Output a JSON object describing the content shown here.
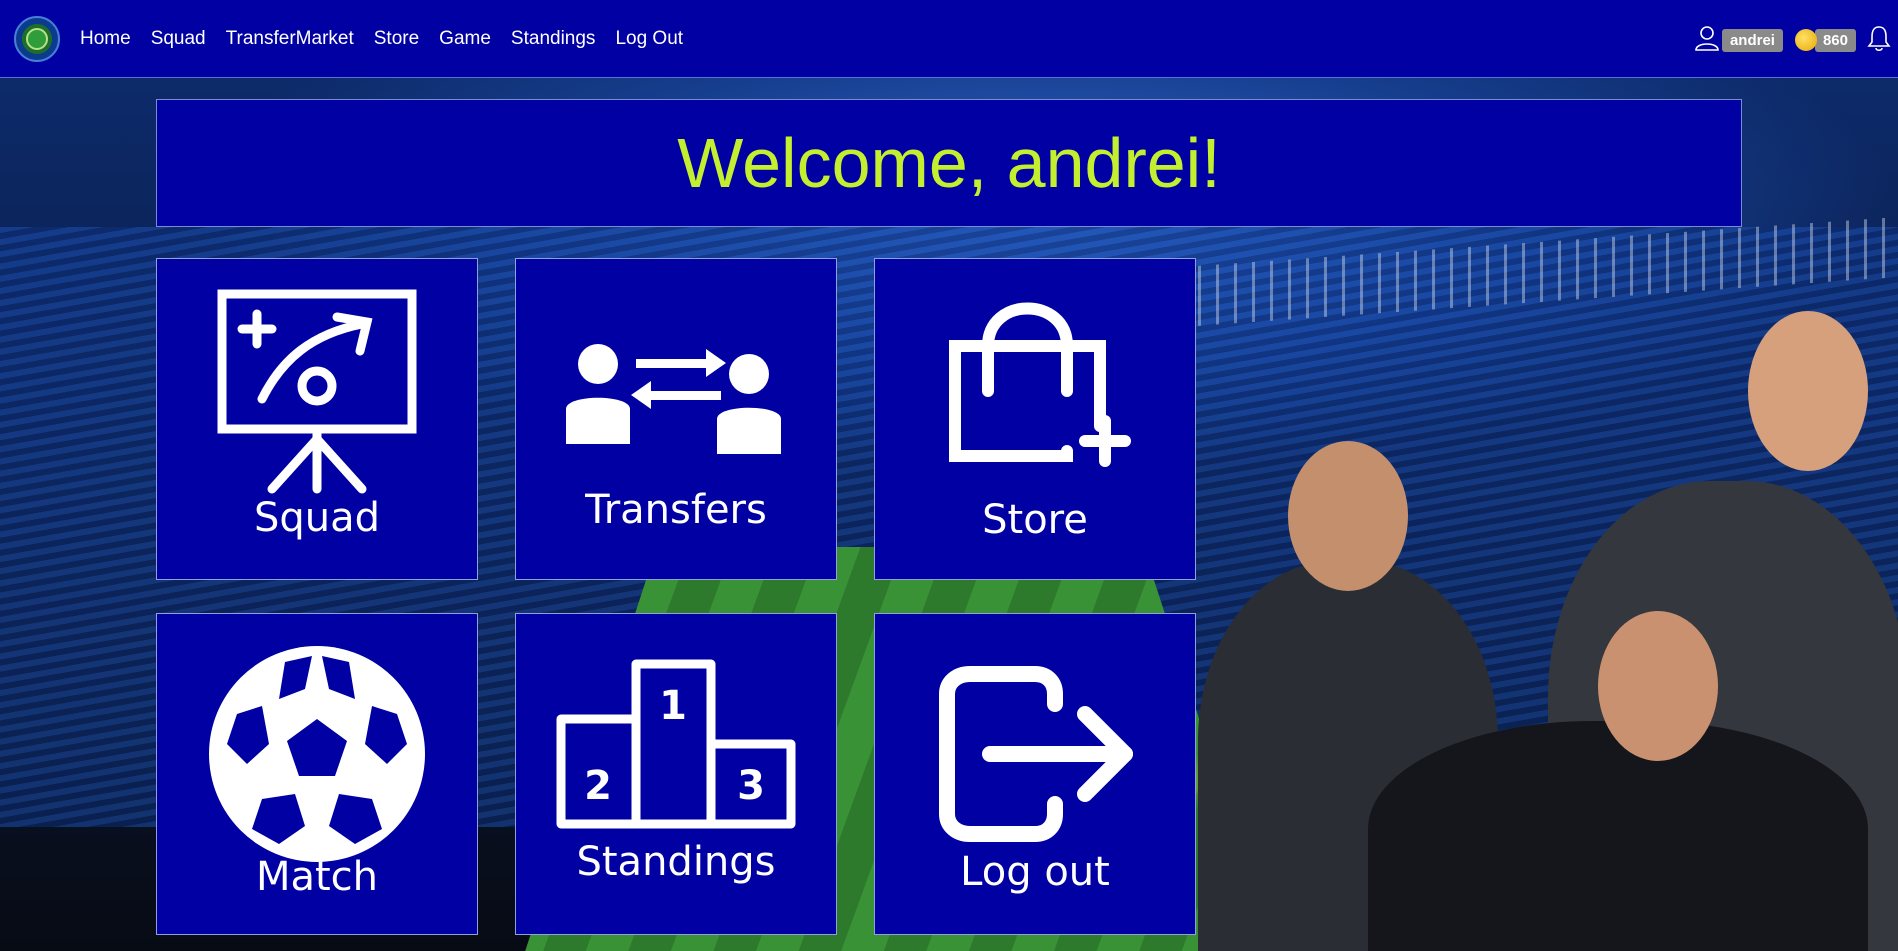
{
  "nav": {
    "links": [
      "Home",
      "Squad",
      "TransferMarket",
      "Store",
      "Game",
      "Standings",
      "Log Out"
    ],
    "username": "andrei",
    "coins": "860",
    "icons": [
      "logo-icon",
      "user-icon",
      "coin-icon",
      "bell-icon"
    ]
  },
  "welcome": {
    "text": "Welcome, andrei!"
  },
  "tiles": [
    {
      "label": "Squad",
      "icon": "tactics-board-icon"
    },
    {
      "label": "Transfers",
      "icon": "transfer-icon"
    },
    {
      "label": "Store",
      "icon": "shopping-bag-plus-icon"
    },
    {
      "label": "Match",
      "icon": "soccer-ball-icon"
    },
    {
      "label": "Standings",
      "icon": "podium-icon"
    },
    {
      "label": "Log out",
      "icon": "logout-icon"
    }
  ],
  "podium": {
    "first": "1",
    "second": "2",
    "third": "3"
  },
  "colors": {
    "navbar": "#0000a3",
    "tile": "#0000a3",
    "welcome_text": "#c4ef2e"
  }
}
